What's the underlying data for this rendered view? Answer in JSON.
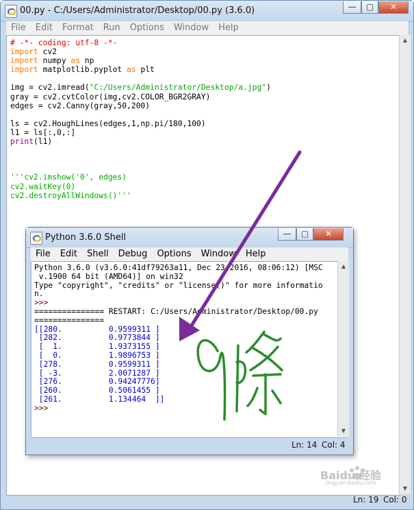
{
  "editor": {
    "title": "00.py - C:/Users/Administrator/Desktop/00.py (3.6.0)",
    "menu": [
      "File",
      "Edit",
      "Format",
      "Run",
      "Options",
      "Window",
      "Help"
    ],
    "code_lines": [
      [
        {
          "t": "# -*- coding: utf-8 -*-",
          "c": "cm"
        }
      ],
      [
        {
          "t": "import",
          "c": "kw"
        },
        {
          "t": " cv2"
        }
      ],
      [
        {
          "t": "import",
          "c": "kw"
        },
        {
          "t": " numpy "
        },
        {
          "t": "as",
          "c": "kw"
        },
        {
          "t": " np"
        }
      ],
      [
        {
          "t": "import",
          "c": "kw"
        },
        {
          "t": " matplotlib.pyplot "
        },
        {
          "t": "as",
          "c": "kw"
        },
        {
          "t": " plt"
        }
      ],
      [
        {
          "t": ""
        }
      ],
      [
        {
          "t": "img = cv2.imread("
        },
        {
          "t": "\"C:/Users/Administrator/Desktop/a.jpg\"",
          "c": "str"
        },
        {
          "t": ")"
        }
      ],
      [
        {
          "t": "gray = cv2.cvtColor(img,cv2.COLOR_BGR2GRAY)"
        }
      ],
      [
        {
          "t": "edges = cv2.Canny(gray,50,200)"
        }
      ],
      [
        {
          "t": ""
        }
      ],
      [
        {
          "t": "ls = cv2.HoughLines(edges,1,np.pi/180,100)"
        }
      ],
      [
        {
          "t": "l1 = ls[:,0,:]"
        }
      ],
      [
        {
          "t": "print",
          "c": "bi"
        },
        {
          "t": "(l1)"
        }
      ],
      [
        {
          "t": ""
        }
      ],
      [
        {
          "t": ""
        }
      ],
      [
        {
          "t": ""
        }
      ],
      [
        {
          "t": "'''cv2.imshow('0', edges)",
          "c": "str"
        }
      ],
      [
        {
          "t": "cv2.waitKey(0)",
          "c": "str"
        }
      ],
      [
        {
          "t": "cv2.destroyAllWindows()'''",
          "c": "str"
        }
      ]
    ],
    "status": {
      "ln": "Ln: 19",
      "col": "Col: 0"
    }
  },
  "shell": {
    "title": "Python 3.6.0 Shell",
    "menu": [
      "File",
      "Edit",
      "Shell",
      "Debug",
      "Options",
      "Window",
      "Help"
    ],
    "lines": [
      {
        "t": "Python 3.6.0 (v3.6.0:41df79263a11, Dec 23 2016, 08:06:12) [MSC",
        "c": ""
      },
      {
        "t": " v.1900 64 bit (AMD64)] on win32",
        "c": ""
      },
      {
        "t": "Type \"copyright\", \"credits\" or \"license()\" for more informatio",
        "c": ""
      },
      {
        "t": "n.",
        "c": ""
      },
      {
        "t": ">>> ",
        "c": "prompt"
      },
      {
        "t": "=============== RESTART: C:/Users/Administrator/Desktop/00.py",
        "c": ""
      },
      {
        "t": "===============",
        "c": ""
      },
      {
        "t": "[[280.          0.9599311 ]",
        "c": "outc"
      },
      {
        "t": " [282.          0.9773844 ]",
        "c": "outc"
      },
      {
        "t": " [  1.          1.9373155 ]",
        "c": "outc"
      },
      {
        "t": " [  0.          1.9896753 ]",
        "c": "outc"
      },
      {
        "t": " [278.          0.9599311 ]",
        "c": "outc"
      },
      {
        "t": " [ -3.          2.0071287 ]",
        "c": "outc"
      },
      {
        "t": " [276.          0.94247776]",
        "c": "outc"
      },
      {
        "t": " [260.          0.5061455 ]",
        "c": "outc"
      },
      {
        "t": " [261.          1.134464  ]]",
        "c": "outc"
      },
      {
        "t": ">>> ",
        "c": "prompt"
      }
    ],
    "status": {
      "ln": "Ln: 14",
      "col": "Col: 4"
    }
  },
  "window_controls": {
    "minimize": "—",
    "maximize": "▢",
    "close": "✕"
  },
  "annotation": {
    "arrow_color": "#7a2c9a",
    "handwriting_color": "#2e8b2e"
  },
  "watermark": {
    "text": "Baidu 经验",
    "sub": "jingyan.baidu.com"
  }
}
